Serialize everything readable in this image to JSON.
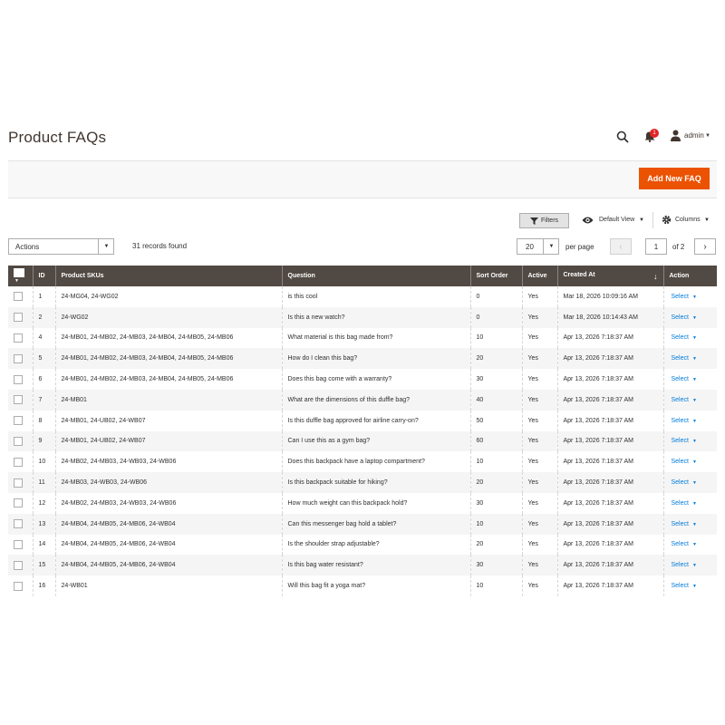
{
  "header": {
    "title": "Product FAQs",
    "notification_count": "1",
    "user": "admin"
  },
  "actions": {
    "add_new": "Add New FAQ"
  },
  "toolbar": {
    "filters": "Filters",
    "view": "Default View",
    "columns": "Columns",
    "mass_actions": "Actions",
    "records_found": "31 records found",
    "per_page_value": "20",
    "per_page_label": "per page",
    "current_page": "1",
    "total_pages": "of 2"
  },
  "grid": {
    "columns": [
      "ID",
      "Product SKUs",
      "Question",
      "Sort Order",
      "Active",
      "Created At",
      "Action"
    ],
    "sort_indicator": "↓",
    "select_label": "Select",
    "rows": [
      {
        "id": "1",
        "skus": "24-MG04, 24-WG02",
        "question": "is this cool",
        "sort": "0",
        "active": "Yes",
        "created": "Mar 18, 2026 10:09:16 AM"
      },
      {
        "id": "2",
        "skus": "24-WG02",
        "question": "Is this a new watch?",
        "sort": "0",
        "active": "Yes",
        "created": "Mar 18, 2026 10:14:43 AM"
      },
      {
        "id": "4",
        "skus": "24-MB01, 24-MB02, 24-MB03, 24-MB04, 24-MB05, 24-MB06",
        "question": "What material is this bag made from?",
        "sort": "10",
        "active": "Yes",
        "created": "Apr 13, 2026 7:18:37 AM"
      },
      {
        "id": "5",
        "skus": "24-MB01, 24-MB02, 24-MB03, 24-MB04, 24-MB05, 24-MB06",
        "question": "How do I clean this bag?",
        "sort": "20",
        "active": "Yes",
        "created": "Apr 13, 2026 7:18:37 AM"
      },
      {
        "id": "6",
        "skus": "24-MB01, 24-MB02, 24-MB03, 24-MB04, 24-MB05, 24-MB06",
        "question": "Does this bag come with a warranty?",
        "sort": "30",
        "active": "Yes",
        "created": "Apr 13, 2026 7:18:37 AM"
      },
      {
        "id": "7",
        "skus": "24-MB01",
        "question": "What are the dimensions of this duffle bag?",
        "sort": "40",
        "active": "Yes",
        "created": "Apr 13, 2026 7:18:37 AM"
      },
      {
        "id": "8",
        "skus": "24-MB01, 24-UB02, 24-WB07",
        "question": "Is this duffle bag approved for airline carry-on?",
        "sort": "50",
        "active": "Yes",
        "created": "Apr 13, 2026 7:18:37 AM"
      },
      {
        "id": "9",
        "skus": "24-MB01, 24-UB02, 24-WB07",
        "question": "Can I use this as a gym bag?",
        "sort": "60",
        "active": "Yes",
        "created": "Apr 13, 2026 7:18:37 AM"
      },
      {
        "id": "10",
        "skus": "24-MB02, 24-MB03, 24-WB03, 24-WB06",
        "question": "Does this backpack have a laptop compartment?",
        "sort": "10",
        "active": "Yes",
        "created": "Apr 13, 2026 7:18:37 AM"
      },
      {
        "id": "11",
        "skus": "24-MB03, 24-WB03, 24-WB06",
        "question": "Is this backpack suitable for hiking?",
        "sort": "20",
        "active": "Yes",
        "created": "Apr 13, 2026 7:18:37 AM"
      },
      {
        "id": "12",
        "skus": "24-MB02, 24-MB03, 24-WB03, 24-WB06",
        "question": "How much weight can this backpack hold?",
        "sort": "30",
        "active": "Yes",
        "created": "Apr 13, 2026 7:18:37 AM"
      },
      {
        "id": "13",
        "skus": "24-MB04, 24-MB05, 24-MB06, 24-WB04",
        "question": "Can this messenger bag hold a tablet?",
        "sort": "10",
        "active": "Yes",
        "created": "Apr 13, 2026 7:18:37 AM"
      },
      {
        "id": "14",
        "skus": "24-MB04, 24-MB05, 24-MB06, 24-WB04",
        "question": "Is the shoulder strap adjustable?",
        "sort": "20",
        "active": "Yes",
        "created": "Apr 13, 2026 7:18:37 AM"
      },
      {
        "id": "15",
        "skus": "24-MB04, 24-MB05, 24-MB06, 24-WB04",
        "question": "Is this bag water resistant?",
        "sort": "30",
        "active": "Yes",
        "created": "Apr 13, 2026 7:18:37 AM"
      },
      {
        "id": "16",
        "skus": "24-WB01",
        "question": "Will this bag fit a yoga mat?",
        "sort": "10",
        "active": "Yes",
        "created": "Apr 13, 2026 7:18:37 AM"
      }
    ]
  }
}
